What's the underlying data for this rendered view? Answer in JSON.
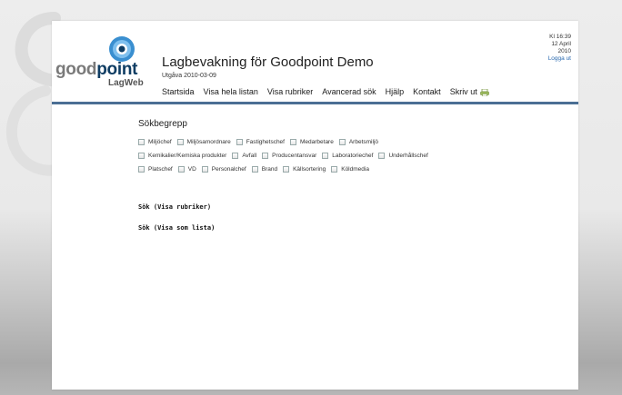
{
  "branding": {
    "logo_part1": "good",
    "logo_part2": "point",
    "logo_sub": "LagWeb"
  },
  "header": {
    "title": "Lagbevakning för Goodpoint Demo",
    "edition": "Utgåva 2010-03-09"
  },
  "meta": {
    "time": "Kl 16:39",
    "date_day": "12 April",
    "year": "2010",
    "logout": "Logga ut"
  },
  "nav": {
    "items": [
      "Startsida",
      "Visa hela listan",
      "Visa rubriker",
      "Avancerad sök",
      "Hjälp",
      "Kontakt",
      "Skriv ut"
    ]
  },
  "search": {
    "section_title": "Sökbegrepp",
    "terms": [
      "Miljöchef",
      "Miljösamordnare",
      "Fastighetschef",
      "Medarbetare",
      "Arbetsmiljö",
      "Kemikalier/Kemiska produkter",
      "Avfall",
      "Producentansvar",
      "Laboratoriechef",
      "Underhållschef",
      "Platschef",
      "VD",
      "Personalchef",
      "Brand",
      "Källsortering",
      "Köldmedia"
    ],
    "action_headings": "Sök (Visa rubriker)",
    "action_list": "Sök (Visa som lista)"
  },
  "colors": {
    "divider": "#4b6f94",
    "logo_blue": "#0f3d63",
    "logo_accent": "#3a8fd0",
    "link": "#2a6ab0"
  }
}
